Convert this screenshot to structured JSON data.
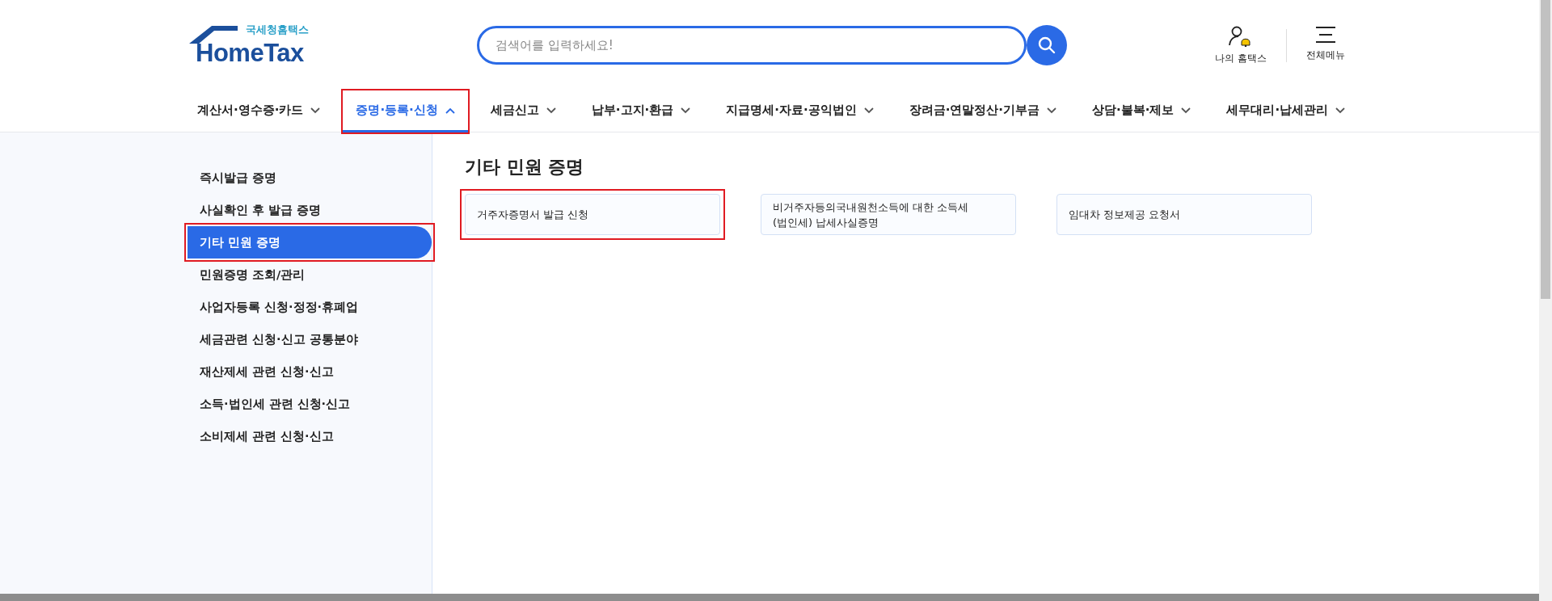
{
  "header": {
    "logo": {
      "caption": "국세청홈택스",
      "wordmark": "HomeTax"
    },
    "search": {
      "placeholder": "검색어를 입력하세요!"
    },
    "utilities": [
      {
        "kind": "my",
        "label": "나의 홈택스"
      },
      {
        "kind": "menu",
        "label": "전체메뉴"
      }
    ]
  },
  "nav": [
    {
      "label": "계산서·영수증·카드",
      "selected": false,
      "highlighted": false
    },
    {
      "label": "증명·등록·신청",
      "selected": true,
      "highlighted": true
    },
    {
      "label": "세금신고",
      "selected": false,
      "highlighted": false
    },
    {
      "label": "납부·고지·환급",
      "selected": false,
      "highlighted": false
    },
    {
      "label": "지급명세·자료·공익법인",
      "selected": false,
      "highlighted": false
    },
    {
      "label": "장려금·연말정산·기부금",
      "selected": false,
      "highlighted": false
    },
    {
      "label": "상담·불복·제보",
      "selected": false,
      "highlighted": false
    },
    {
      "label": "세무대리·납세관리",
      "selected": false,
      "highlighted": false
    }
  ],
  "sidebar": {
    "items": [
      {
        "label": "즉시발급 증명",
        "selected": false,
        "highlighted": false
      },
      {
        "label": "사실확인 후 발급 증명",
        "selected": false,
        "highlighted": false
      },
      {
        "label": "기타 민원 증명",
        "selected": true,
        "highlighted": true
      },
      {
        "label": "민원증명 조회/관리",
        "selected": false,
        "highlighted": false
      },
      {
        "label": "사업자등록 신청·정정·휴폐업",
        "selected": false,
        "highlighted": false
      },
      {
        "label": "세금관련 신청·신고 공통분야",
        "selected": false,
        "highlighted": false
      },
      {
        "label": "재산제세 관련 신청·신고",
        "selected": false,
        "highlighted": false
      },
      {
        "label": "소득·법인세 관련 신청·신고",
        "selected": false,
        "highlighted": false
      },
      {
        "label": "소비제세 관련 신청·신고",
        "selected": false,
        "highlighted": false
      }
    ]
  },
  "content": {
    "title": "기타 민원 증명",
    "cards": [
      {
        "label": "거주자증명서 발급 신청",
        "highlighted": true
      },
      {
        "label": "비거주자등의국내원천소득에 대한 소득세 (법인세) 납세사실증명",
        "highlighted": false
      },
      {
        "label": "임대차 정보제공 요청서",
        "highlighted": false
      }
    ]
  }
}
